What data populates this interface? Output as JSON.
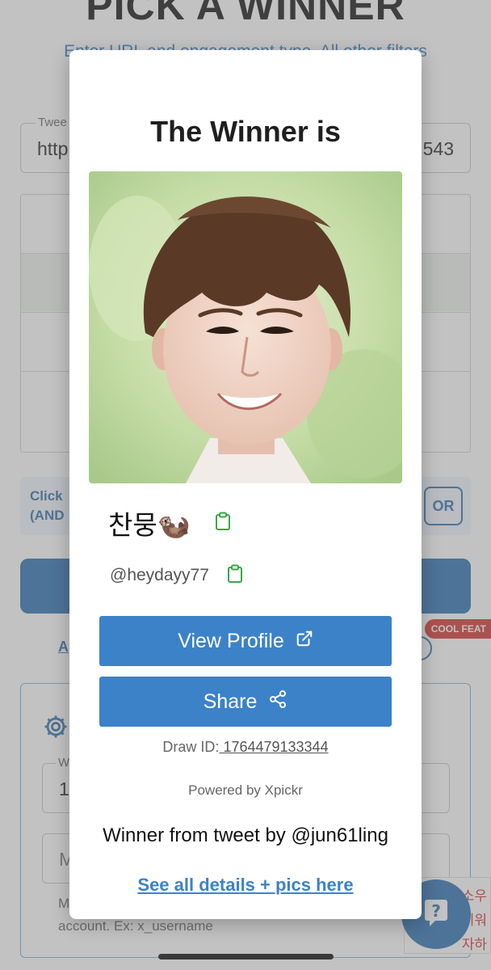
{
  "background": {
    "title": "PICK A WINNER",
    "subtitle": "Enter URL and engagement type. All other filters",
    "tweet_field": {
      "label": "Twee",
      "value_left": "http",
      "value_right": "543"
    },
    "hint": {
      "line1": "Click",
      "line2": "(AND",
      "or_button": "OR"
    },
    "cool_badge": "COOL FEAT",
    "link_a": "A",
    "settings": {
      "input1": {
        "label": "W",
        "value": "1"
      },
      "input2": {
        "placeholder": "M"
      },
      "helper_line1": "M",
      "helper_line2": "account. Ex: x_username"
    },
    "ad": {
      "line1": "소우",
      "line2": "키워",
      "line3": "자하"
    }
  },
  "modal": {
    "title": "The Winner is",
    "winner_name": "찬뭉🦦",
    "winner_handle": "@heydayy77",
    "view_profile_label": "View Profile",
    "share_label": "Share",
    "draw_id_prefix": "Draw ID:",
    "draw_id": " 1764479133344",
    "powered_by": "Powered by Xpickr",
    "from_tweet": "Winner from tweet by @jun61ling",
    "details_link": "See all details + pics here"
  },
  "colors": {
    "primary_button": "#3c82c8",
    "link": "#3c82c8",
    "copy_icon": "#3aa64a",
    "cool_badge": "#d3332e"
  },
  "icons": {
    "copy": "clipboard-icon",
    "external": "external-link-icon",
    "share": "share-icon",
    "settings": "gear-icon",
    "help": "help-bubble-icon"
  }
}
